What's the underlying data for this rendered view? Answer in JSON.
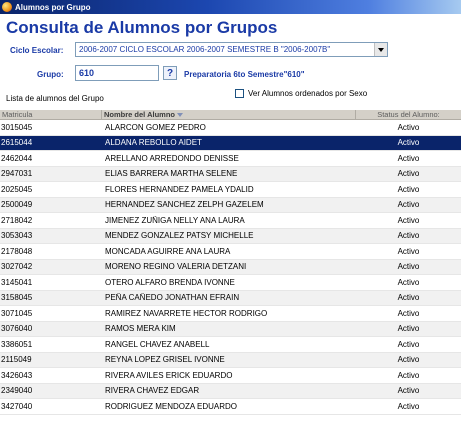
{
  "window": {
    "title": "Alumnos por Grupo"
  },
  "page": {
    "heading": "Consulta de Alumnos por Grupos"
  },
  "filters": {
    "ciclo_label": "Ciclo Escolar:",
    "ciclo_value": "2006-2007 CICLO ESCOLAR 2006-2007 SEMESTRE B \"2006-2007B\"",
    "grupo_label": "Grupo:",
    "grupo_value": "610",
    "help_label": "?",
    "grupo_description": "Preparatoria 6to Semestre\"610\"",
    "list_caption": "Lista de alumnos del Grupo",
    "sort_checkbox_label": "Ver Alumnos ordenados por Sexo",
    "sort_checked": false
  },
  "grid": {
    "columns": [
      "Matricula",
      "Nombre del Alumno",
      "Status del Alumno:"
    ],
    "selected_index": 1,
    "rows": [
      [
        "3015045",
        "ALARCON GOMEZ PEDRO",
        "Activo"
      ],
      [
        "2615044",
        "ALDANA REBOLLO AIDET",
        "Activo"
      ],
      [
        "2462044",
        "ARELLANO ARREDONDO DENISSE",
        "Activo"
      ],
      [
        "2947031",
        "ELIAS BARRERA MARTHA SELENE",
        "Activo"
      ],
      [
        "2025045",
        "FLORES HERNANDEZ PAMELA YDALID",
        "Activo"
      ],
      [
        "2500049",
        "HERNANDEZ SANCHEZ ZELPH GAZELEM",
        "Activo"
      ],
      [
        "2718042",
        "JIMENEZ ZUÑIGA  NELLY ANA LAURA",
        "Activo"
      ],
      [
        "3053043",
        "MENDEZ GONZALEZ PATSY MICHELLE",
        "Activo"
      ],
      [
        "2178048",
        "MONCADA AGUIRRE ANA LAURA",
        "Activo"
      ],
      [
        "3027042",
        "MORENO REGINO VALERIA DETZANI",
        "Activo"
      ],
      [
        "3145041",
        "OTERO ALFARO BRENDA IVONNE",
        "Activo"
      ],
      [
        "3158045",
        "PEÑA CAÑEDO JONATHAN EFRAIN",
        "Activo"
      ],
      [
        "3071045",
        "RAMIREZ NAVARRETE HECTOR RODRIGO",
        "Activo"
      ],
      [
        "3076040",
        "RAMOS MERA KIM",
        "Activo"
      ],
      [
        "3386051",
        "RANGEL CHAVEZ ANABELL",
        "Activo"
      ],
      [
        "2115049",
        "REYNA LOPEZ GRISEL IVONNE",
        "Activo"
      ],
      [
        "3426043",
        "RIVERA AVILES ERICK EDUARDO",
        "Activo"
      ],
      [
        "2349040",
        "RIVERA CHAVEZ EDGAR",
        "Activo"
      ],
      [
        "3427040",
        "RODRIGUEZ MENDOZA EDUARDO",
        "Activo"
      ]
    ]
  }
}
